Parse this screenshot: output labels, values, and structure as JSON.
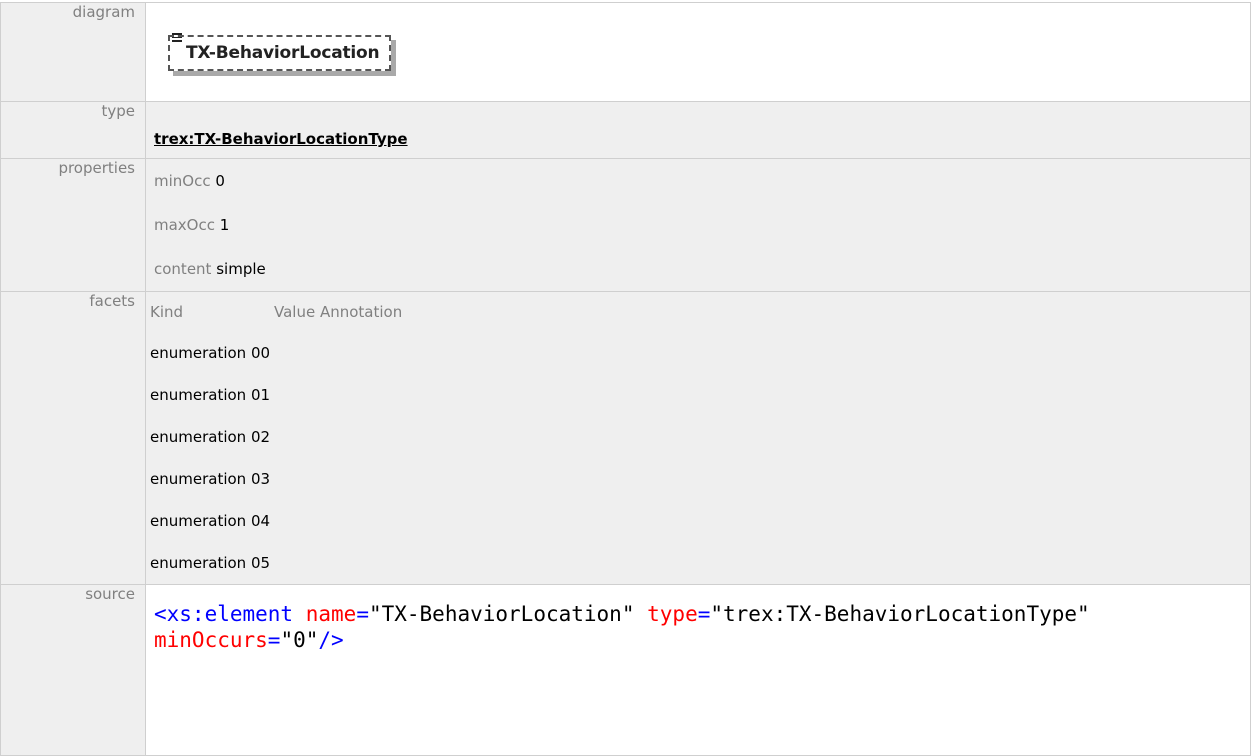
{
  "labels": {
    "diagram": "diagram",
    "type": "type",
    "properties": "properties",
    "facets": "facets",
    "source": "source"
  },
  "diagram": {
    "element_name": "TX-BehaviorLocation",
    "icon": "element-list-icon"
  },
  "type": {
    "link_text": "trex:TX-BehaviorLocationType"
  },
  "properties": [
    {
      "key": "minOcc",
      "value": "0"
    },
    {
      "key": "maxOcc",
      "value": "1"
    },
    {
      "key": "content",
      "value": "simple"
    }
  ],
  "facets": {
    "header_kind": "Kind",
    "header_value_annotation": "Value Annotation",
    "rows": [
      {
        "kind": "enumeration",
        "value": "00"
      },
      {
        "kind": "enumeration",
        "value": "01"
      },
      {
        "kind": "enumeration",
        "value": "02"
      },
      {
        "kind": "enumeration",
        "value": "03"
      },
      {
        "kind": "enumeration",
        "value": "04"
      },
      {
        "kind": "enumeration",
        "value": "05"
      }
    ]
  },
  "source": {
    "tag_open": "<xs:element",
    "attr1_name": "name",
    "attr1_value": "\"TX-BehaviorLocation\"",
    "attr2_name": "type",
    "attr2_value": "\"trex:TX-BehaviorLocationType\"",
    "attr3_name": "minOccurs",
    "attr3_value": "\"0\"",
    "tag_close": "/>",
    "equals": "="
  },
  "colors": {
    "label_text": "#808080",
    "cell_bg": "#efefef",
    "xml_tag": "#0000ff",
    "xml_attr": "#ff0000"
  }
}
